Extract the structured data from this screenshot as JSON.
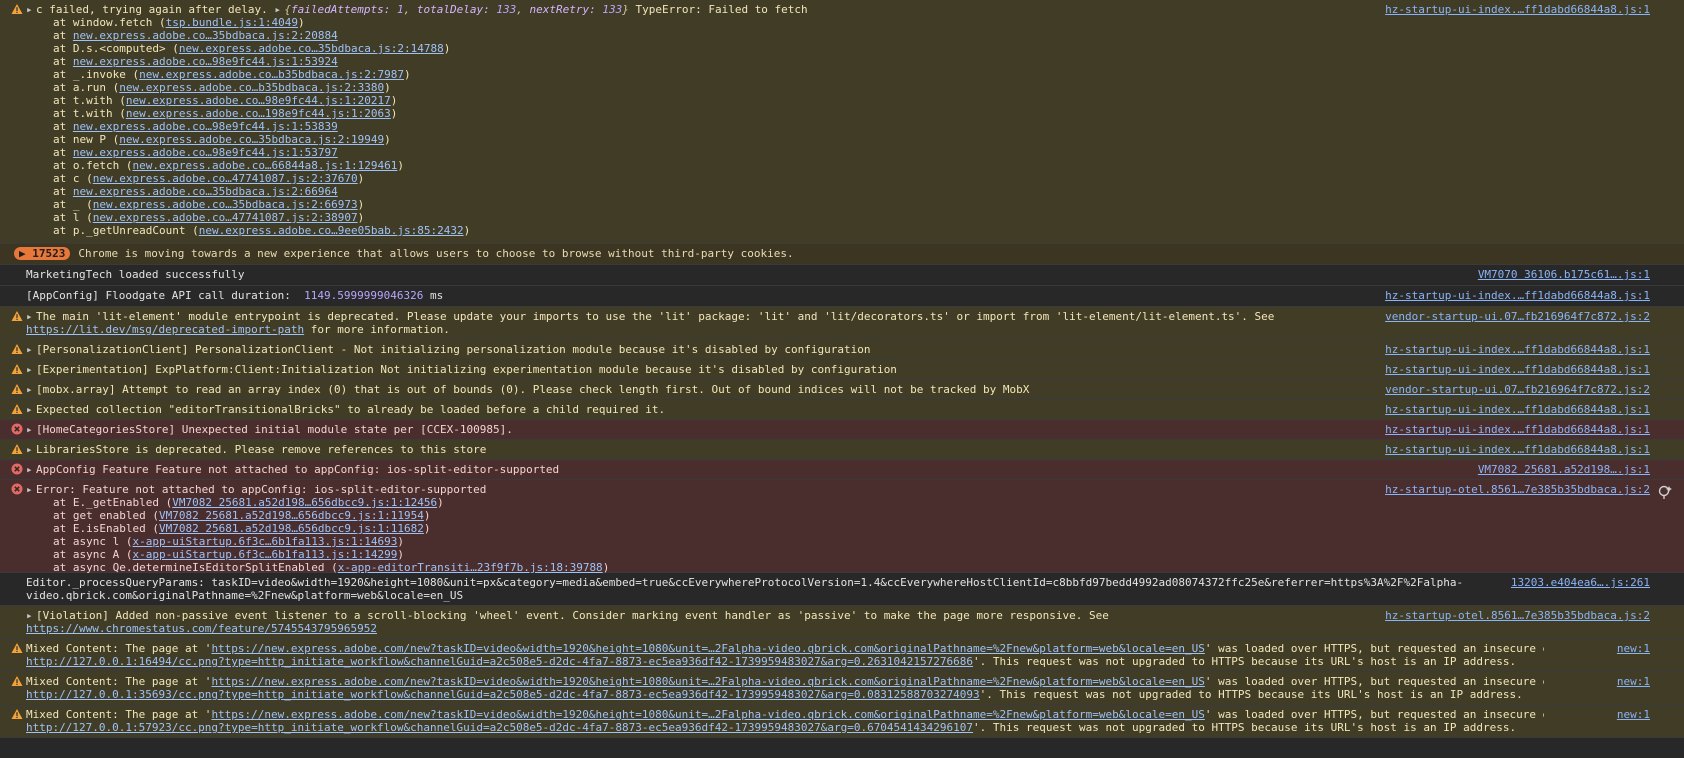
{
  "colors": {
    "warning_bg": "#413c26",
    "error_bg": "#4a2d2d",
    "link": "#8ab4f8",
    "warning_icon": "#f2a33a",
    "error_icon": "#e46962",
    "issue_badge": "#e8773a"
  },
  "entries": {
    "e1": {
      "head": "c failed, trying again after delay. ",
      "obj_a": "{",
      "k1": "failedAttempts",
      "v1": "1",
      "k2": "totalDelay",
      "v2": "133",
      "k3": "nextRetry",
      "v3": "133",
      "obj_b": "}",
      "tail": " TypeError: Failed to fetch",
      "source": "hz-startup-ui-index.…ff1dabd66844a8.js:1",
      "stack": [
        {
          "pre": "at window.fetch (",
          "link": "tsp.bundle.js:1:4049",
          "post": ")"
        },
        {
          "pre": "at ",
          "link": "new.express.adobe.co…35bdbaca.js:2:20884",
          "post": ""
        },
        {
          "pre": "at D.s.<computed> (",
          "link": "new.express.adobe.co…35bdbaca.js:2:14788",
          "post": ")"
        },
        {
          "pre": "at ",
          "link": "new.express.adobe.co…98e9fc44.js:1:53924",
          "post": ""
        },
        {
          "pre": "at _.invoke (",
          "link": "new.express.adobe.co…b35bdbaca.js:2:7987",
          "post": ")"
        },
        {
          "pre": "at a.run (",
          "link": "new.express.adobe.co…b35bdbaca.js:2:3380",
          "post": ")"
        },
        {
          "pre": "at t.with (",
          "link": "new.express.adobe.co…98e9fc44.js:1:20217",
          "post": ")"
        },
        {
          "pre": "at t.with (",
          "link": "new.express.adobe.co…198e9fc44.js:1:2063",
          "post": ")"
        },
        {
          "pre": "at ",
          "link": "new.express.adobe.co…98e9fc44.js:1:53839",
          "post": ""
        },
        {
          "pre": "at new P (",
          "link": "new.express.adobe.co…35bdbaca.js:2:19949",
          "post": ")"
        },
        {
          "pre": "at ",
          "link": "new.express.adobe.co…98e9fc44.js:1:53797",
          "post": ""
        },
        {
          "pre": "at o.fetch (",
          "link": "new.express.adobe.co…66844a8.js:1:129461",
          "post": ")"
        },
        {
          "pre": "at c (",
          "link": "new.express.adobe.co…47741087.js:2:37670",
          "post": ")"
        },
        {
          "pre": "at ",
          "link": "new.express.adobe.co…35bdbaca.js:2:66964",
          "post": ""
        },
        {
          "pre": "at _ (",
          "link": "new.express.adobe.co…35bdbaca.js:2:66973",
          "post": ")"
        },
        {
          "pre": "at l (",
          "link": "new.express.adobe.co…47741087.js:2:38907",
          "post": ")"
        },
        {
          "pre": "at p._getUnreadCount (",
          "link": "new.express.adobe.co…9ee05bab.js:85:2432",
          "post": ")"
        }
      ]
    },
    "e2": {
      "badge": "17523",
      "text": "Chrome is moving towards a new experience that allows users to choose to browse without third-party cookies."
    },
    "e3": {
      "text": "MarketingTech loaded successfully",
      "source": "VM7070 36106.b175c61….js:1"
    },
    "e4": {
      "text": "[AppConfig] Floodgate API call duration:  ",
      "value": "1149.5999999046326",
      "unit": " ms",
      "source": "hz-startup-ui-index.…ff1dabd66844a8.js:1"
    },
    "e5": {
      "text": "The main 'lit-element' module entrypoint is deprecated. Please update your imports to use the 'lit' package: 'lit' and 'lit/decorators.ts' or import from 'lit-element/lit-element.ts'. See",
      "link": "https://lit.dev/msg/deprecated-import-path",
      "tail": " for more information.",
      "source": "vendor-startup-ui.07…fb216964f7c872.js:2"
    },
    "e6": {
      "text": "[PersonalizationClient] PersonalizationClient - Not initializing personalization module because it's disabled by configuration",
      "source": "hz-startup-ui-index.…ff1dabd66844a8.js:1"
    },
    "e7": {
      "text": "[Experimentation] ExpPlatform:Client:Initialization Not initializing experimentation module because it's disabled by configuration",
      "source": "hz-startup-ui-index.…ff1dabd66844a8.js:1"
    },
    "e8": {
      "text": "[mobx.array] Attempt to read an array index (0) that is out of bounds (0). Please check length first. Out of bound indices will not be tracked by MobX",
      "source": "vendor-startup-ui.07…fb216964f7c872.js:2"
    },
    "e9": {
      "text": "Expected collection \"editorTransitionalBricks\" to already be loaded before a child required it.",
      "source": "hz-startup-ui-index.…ff1dabd66844a8.js:1"
    },
    "e10": {
      "text": "[HomeCategoriesStore] Unexpected initial module state per [CCEX-100985].",
      "source": "hz-startup-ui-index.…ff1dabd66844a8.js:1"
    },
    "e11": {
      "text": "LibrariesStore is deprecated. Please remove references to this store",
      "source": "hz-startup-ui-index.…ff1dabd66844a8.js:1"
    },
    "e12": {
      "text": "AppConfig Feature Feature not attached to appConfig: ios-split-editor-supported",
      "source": "VM7082 25681.a52d198….js:1"
    },
    "e13": {
      "text": "Error: Feature not attached to appConfig: ios-split-editor-supported",
      "source": "hz-startup-otel.8561…7e385b35bdbaca.js:2",
      "stack": [
        {
          "pre": "at E._getEnabled (",
          "link": "VM7082 25681.a52d198…656dbcc9.js:1:12456",
          "post": ")"
        },
        {
          "pre": "at get enabled (",
          "link": "VM7082 25681.a52d198…656dbcc9.js:1:11954",
          "post": ")"
        },
        {
          "pre": "at E.isEnabled (",
          "link": "VM7082 25681.a52d198…656dbcc9.js:1:11682",
          "post": ")"
        },
        {
          "pre": "at async l (",
          "link": "x-app-uiStartup.6f3c…6b1fa113.js:1:14693",
          "post": ")"
        },
        {
          "pre": "at async A (",
          "link": "x-app-uiStartup.6f3c…6b1fa113.js:1:14299",
          "post": ")"
        },
        {
          "pre": "at async Qe.determineIsEditorSplitEnabled (",
          "link": "x-app-editorTransiti…23f9f7b.js:18:39788",
          "post": ")"
        }
      ]
    },
    "e14": {
      "line1": "Editor._processQueryParams: taskID=video&width=1920&height=1080&unit=px&category=media&embed=true&ccEverywhereProtocolVersion=1.4&ccEverywhereHostClientId=c8bbfd97bedd4992ad08074372ffc25e&referrer=https%3A%2F%2Falpha-",
      "line2": "video.qbrick.com&originalPathname=%2Fnew&platform=web&locale=en_US",
      "source": "13203.e404ea6….js:261"
    },
    "e15": {
      "text": "[Violation] Added non-passive event listener to a scroll-blocking 'wheel' event. Consider marking event handler as 'passive' to make the page more responsive. See",
      "link": "https://www.chromestatus.com/feature/5745543795965952",
      "source": "hz-startup-otel.8561…7e385b35bdbaca.js:2"
    },
    "mixed": [
      {
        "pre": "Mixed Content: The page at '",
        "page": "https://new.express.adobe.com/new?taskID=video&width=1920&height=1080&unit=…2Falpha-video.qbrick.com&originalPathname=%2Fnew&platform=web&locale=en_US",
        "mid": "' was loaded over HTTPS, but requested an insecure element '",
        "el": "http://127.0.0.1:16494/cc.png?type=http_initiate_workflow&channelGuid=a2c508e5-d2dc-4fa7-8873-ec5ea936df42-1739959483027&arg=0.2631042157276686",
        "post": "'. This request was not upgraded to HTTPS because its URL's host is an IP address.",
        "source": "new:1"
      },
      {
        "pre": "Mixed Content: The page at '",
        "page": "https://new.express.adobe.com/new?taskID=video&width=1920&height=1080&unit=…2Falpha-video.qbrick.com&originalPathname=%2Fnew&platform=web&locale=en_US",
        "mid": "' was loaded over HTTPS, but requested an insecure element '",
        "el": "http://127.0.0.1:35693/cc.png?type=http_initiate_workflow&channelGuid=a2c508e5-d2dc-4fa7-8873-ec5ea936df42-1739959483027&arg=0.08312588703274093",
        "post": "'. This request was not upgraded to HTTPS because its URL's host is an IP address.",
        "source": "new:1"
      },
      {
        "pre": "Mixed Content: The page at '",
        "page": "https://new.express.adobe.com/new?taskID=video&width=1920&height=1080&unit=…2Falpha-video.qbrick.com&originalPathname=%2Fnew&platform=web&locale=en_US",
        "mid": "' was loaded over HTTPS, but requested an insecure element '",
        "el": "http://127.0.0.1:57923/cc.png?type=http_initiate_workflow&channelGuid=a2c508e5-d2dc-4fa7-8873-ec5ea936df42-1739959483027&arg=0.6704541434296107",
        "post": "'. This request was not upgraded to HTTPS because its URL's host is an IP address.",
        "source": "new:1"
      }
    ]
  }
}
